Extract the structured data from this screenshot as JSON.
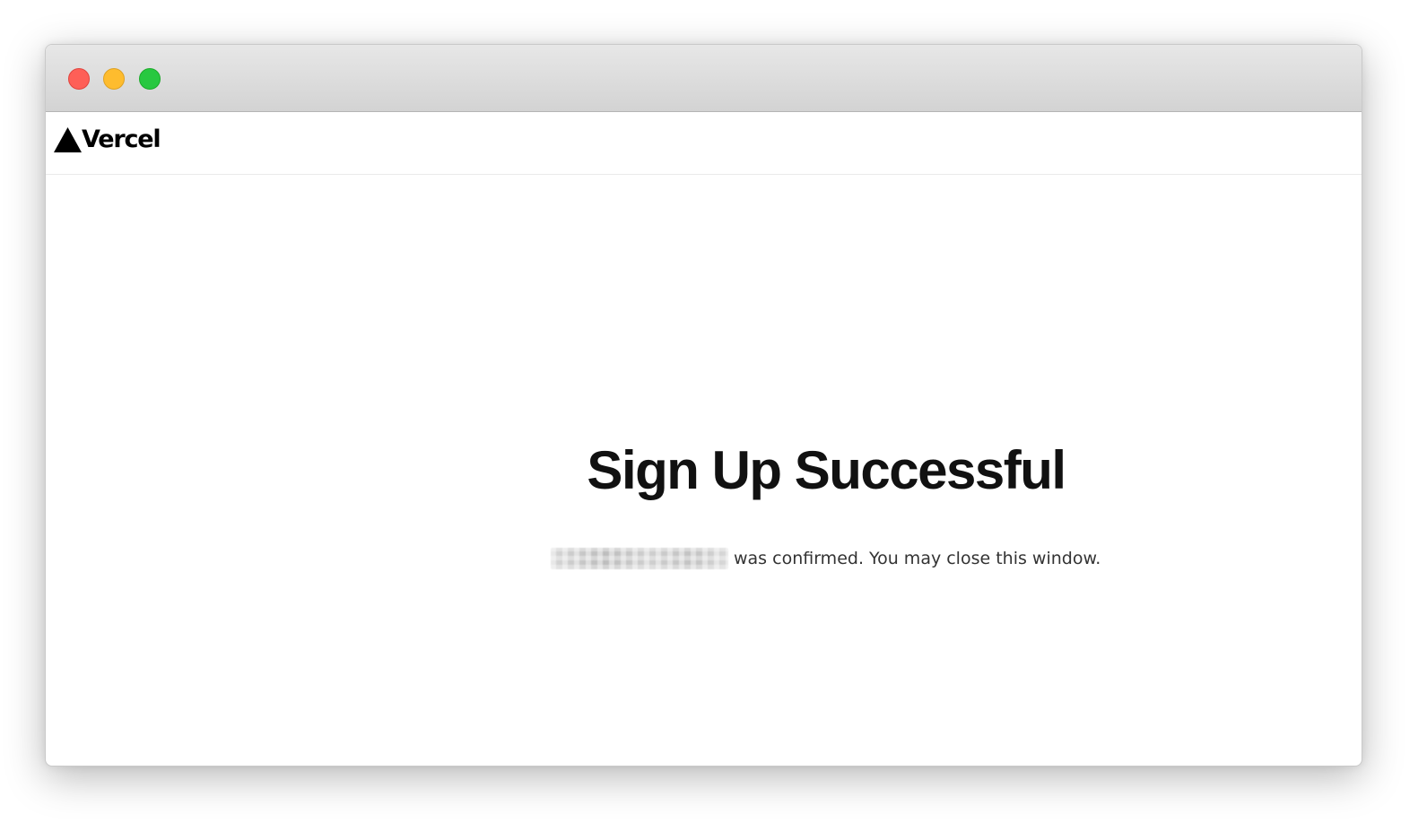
{
  "window": {
    "traffic_lights": [
      {
        "name": "close",
        "color": "#fe5f57"
      },
      {
        "name": "minimize",
        "color": "#febc2e"
      },
      {
        "name": "zoom",
        "color": "#28c840"
      }
    ]
  },
  "navbar": {
    "logo_icon": "vercel-triangle-icon",
    "logo_text": "Vercel"
  },
  "main": {
    "heading": "Sign Up Successful",
    "message": "was confirmed. You may close this window."
  },
  "colors": {
    "heading": "#111111",
    "text": "#333333",
    "logo": "#000000"
  }
}
